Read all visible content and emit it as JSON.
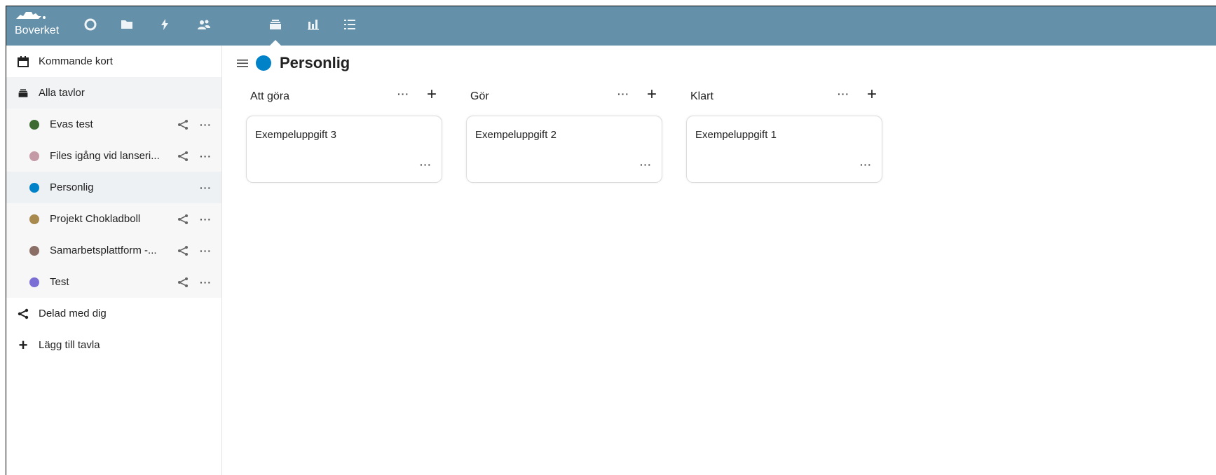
{
  "header": {
    "logo_text": "Boverket",
    "apps": [
      {
        "name": "dashboard-icon"
      },
      {
        "name": "files-icon"
      },
      {
        "name": "activity-icon"
      },
      {
        "name": "contacts-icon"
      },
      {
        "name": "deck-icon"
      },
      {
        "name": "analytics-icon"
      },
      {
        "name": "tasks-icon"
      }
    ],
    "bar_color": "#6490aa"
  },
  "sidebar": {
    "upcoming": "Kommande kort",
    "all_boards": "Alla tavlor",
    "boards": [
      {
        "label": "Evas test",
        "color": "#3d6b32",
        "shared": true
      },
      {
        "label": "Files igång vid lanseri...",
        "color": "#c49aa6",
        "shared": true
      },
      {
        "label": "Personlig",
        "color": "#0082c9",
        "shared": false
      },
      {
        "label": "Projekt Chokladboll",
        "color": "#a88a4f",
        "shared": true
      },
      {
        "label": "Samarbetsplattform -...",
        "color": "#8b6f66",
        "shared": true
      },
      {
        "label": "Test",
        "color": "#7b6fd6",
        "shared": true
      }
    ],
    "shared_with_me": "Delad med dig",
    "add_board": "Lägg till tavla"
  },
  "board": {
    "title": "Personlig",
    "color": "#0082c9",
    "stacks": [
      {
        "title": "Att göra",
        "cards": [
          {
            "title": "Exempeluppgift 3"
          }
        ]
      },
      {
        "title": "Gör",
        "cards": [
          {
            "title": "Exempeluppgift 2"
          }
        ]
      },
      {
        "title": "Klart",
        "cards": [
          {
            "title": "Exempeluppgift 1"
          }
        ]
      }
    ]
  }
}
